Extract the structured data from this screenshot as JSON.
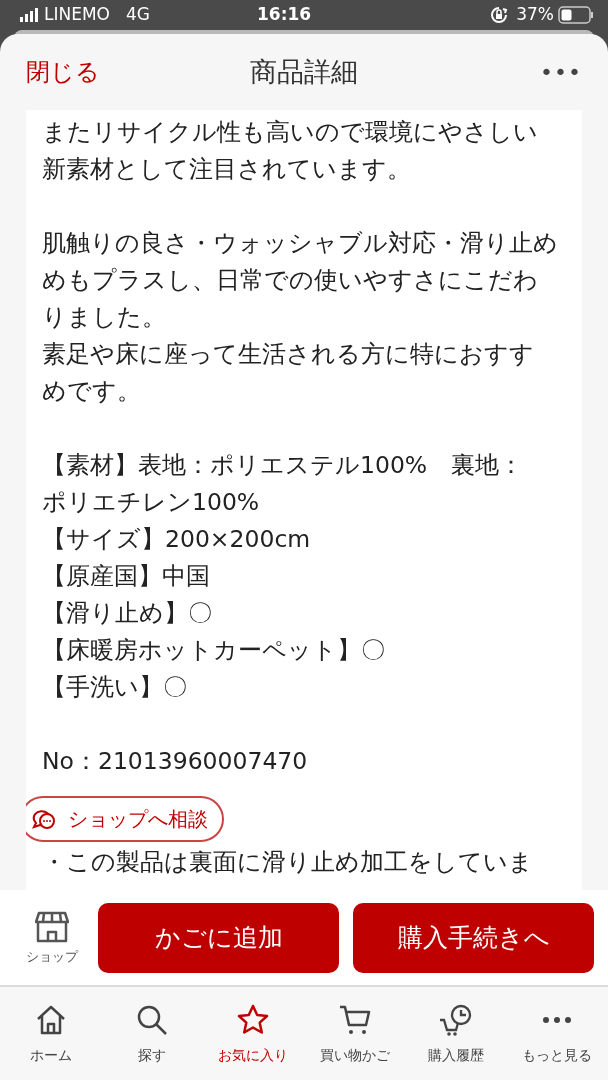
{
  "status_bar": {
    "carrier": "LINEMO",
    "network": "4G",
    "time": "16:16",
    "battery": "37%"
  },
  "header": {
    "close": "閉じる",
    "title": "商品詳細",
    "menu": "•••"
  },
  "description": [
    [
      "またリサイクル性も高いので環境にやさしい",
      "新素材として注目されています。"
    ],
    [
      "肌触りの良さ・ウォッシャブル対応・滑り止め",
      "めもプラスし、日常での使いやすさにこだわ",
      "りました。",
      "素足や床に座って生活される方に特におすす",
      "めです。"
    ],
    [
      "【素材】表地：ポリエステル100%　裏地：",
      "ポリエチレン100%",
      "【サイズ】200×200cm",
      "【原産国】中国",
      "【滑り止め】〇",
      "【床暖房ホットカーペット】〇",
      "【手洗い】〇"
    ],
    [
      "No：21013960007470"
    ],
    [
      "・この製品は裏面に滑り止め加工をしていま"
    ]
  ],
  "consult_button": "ショップへ相談",
  "action_bar": {
    "shop": "ショップ",
    "add_to_cart": "かごに追加",
    "checkout": "購入手続きへ"
  },
  "tab_bar": [
    {
      "kind": "home",
      "label": "ホーム",
      "selected": false
    },
    {
      "kind": "search",
      "label": "探す",
      "selected": false
    },
    {
      "kind": "star",
      "label": "お気に入り",
      "selected": true
    },
    {
      "kind": "cart",
      "label": "買い物かご",
      "selected": false
    },
    {
      "kind": "history",
      "label": "購入履歴",
      "selected": false
    },
    {
      "kind": "more",
      "label": "もっと見る",
      "selected": false
    }
  ]
}
